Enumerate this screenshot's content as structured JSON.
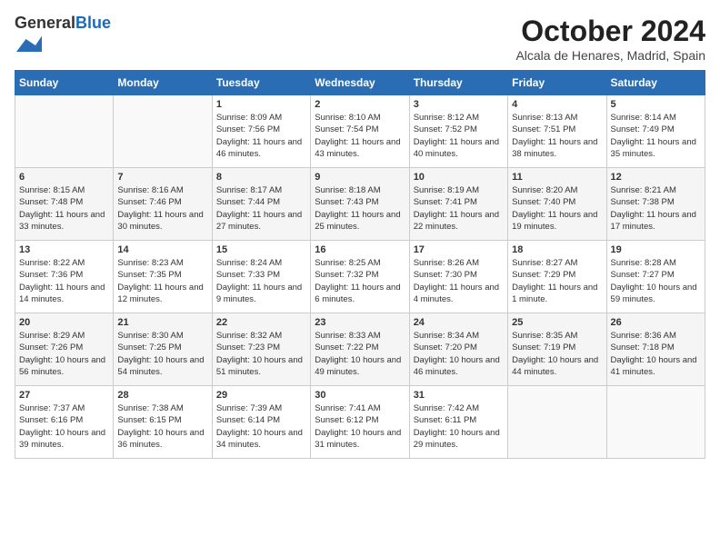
{
  "header": {
    "logo_general": "General",
    "logo_blue": "Blue",
    "month_title": "October 2024",
    "location": "Alcala de Henares, Madrid, Spain"
  },
  "weekdays": [
    "Sunday",
    "Monday",
    "Tuesday",
    "Wednesday",
    "Thursday",
    "Friday",
    "Saturday"
  ],
  "weeks": [
    [
      {
        "day": "",
        "sunrise": "",
        "sunset": "",
        "daylight": ""
      },
      {
        "day": "",
        "sunrise": "",
        "sunset": "",
        "daylight": ""
      },
      {
        "day": "1",
        "sunrise": "Sunrise: 8:09 AM",
        "sunset": "Sunset: 7:56 PM",
        "daylight": "Daylight: 11 hours and 46 minutes."
      },
      {
        "day": "2",
        "sunrise": "Sunrise: 8:10 AM",
        "sunset": "Sunset: 7:54 PM",
        "daylight": "Daylight: 11 hours and 43 minutes."
      },
      {
        "day": "3",
        "sunrise": "Sunrise: 8:12 AM",
        "sunset": "Sunset: 7:52 PM",
        "daylight": "Daylight: 11 hours and 40 minutes."
      },
      {
        "day": "4",
        "sunrise": "Sunrise: 8:13 AM",
        "sunset": "Sunset: 7:51 PM",
        "daylight": "Daylight: 11 hours and 38 minutes."
      },
      {
        "day": "5",
        "sunrise": "Sunrise: 8:14 AM",
        "sunset": "Sunset: 7:49 PM",
        "daylight": "Daylight: 11 hours and 35 minutes."
      }
    ],
    [
      {
        "day": "6",
        "sunrise": "Sunrise: 8:15 AM",
        "sunset": "Sunset: 7:48 PM",
        "daylight": "Daylight: 11 hours and 33 minutes."
      },
      {
        "day": "7",
        "sunrise": "Sunrise: 8:16 AM",
        "sunset": "Sunset: 7:46 PM",
        "daylight": "Daylight: 11 hours and 30 minutes."
      },
      {
        "day": "8",
        "sunrise": "Sunrise: 8:17 AM",
        "sunset": "Sunset: 7:44 PM",
        "daylight": "Daylight: 11 hours and 27 minutes."
      },
      {
        "day": "9",
        "sunrise": "Sunrise: 8:18 AM",
        "sunset": "Sunset: 7:43 PM",
        "daylight": "Daylight: 11 hours and 25 minutes."
      },
      {
        "day": "10",
        "sunrise": "Sunrise: 8:19 AM",
        "sunset": "Sunset: 7:41 PM",
        "daylight": "Daylight: 11 hours and 22 minutes."
      },
      {
        "day": "11",
        "sunrise": "Sunrise: 8:20 AM",
        "sunset": "Sunset: 7:40 PM",
        "daylight": "Daylight: 11 hours and 19 minutes."
      },
      {
        "day": "12",
        "sunrise": "Sunrise: 8:21 AM",
        "sunset": "Sunset: 7:38 PM",
        "daylight": "Daylight: 11 hours and 17 minutes."
      }
    ],
    [
      {
        "day": "13",
        "sunrise": "Sunrise: 8:22 AM",
        "sunset": "Sunset: 7:36 PM",
        "daylight": "Daylight: 11 hours and 14 minutes."
      },
      {
        "day": "14",
        "sunrise": "Sunrise: 8:23 AM",
        "sunset": "Sunset: 7:35 PM",
        "daylight": "Daylight: 11 hours and 12 minutes."
      },
      {
        "day": "15",
        "sunrise": "Sunrise: 8:24 AM",
        "sunset": "Sunset: 7:33 PM",
        "daylight": "Daylight: 11 hours and 9 minutes."
      },
      {
        "day": "16",
        "sunrise": "Sunrise: 8:25 AM",
        "sunset": "Sunset: 7:32 PM",
        "daylight": "Daylight: 11 hours and 6 minutes."
      },
      {
        "day": "17",
        "sunrise": "Sunrise: 8:26 AM",
        "sunset": "Sunset: 7:30 PM",
        "daylight": "Daylight: 11 hours and 4 minutes."
      },
      {
        "day": "18",
        "sunrise": "Sunrise: 8:27 AM",
        "sunset": "Sunset: 7:29 PM",
        "daylight": "Daylight: 11 hours and 1 minute."
      },
      {
        "day": "19",
        "sunrise": "Sunrise: 8:28 AM",
        "sunset": "Sunset: 7:27 PM",
        "daylight": "Daylight: 10 hours and 59 minutes."
      }
    ],
    [
      {
        "day": "20",
        "sunrise": "Sunrise: 8:29 AM",
        "sunset": "Sunset: 7:26 PM",
        "daylight": "Daylight: 10 hours and 56 minutes."
      },
      {
        "day": "21",
        "sunrise": "Sunrise: 8:30 AM",
        "sunset": "Sunset: 7:25 PM",
        "daylight": "Daylight: 10 hours and 54 minutes."
      },
      {
        "day": "22",
        "sunrise": "Sunrise: 8:32 AM",
        "sunset": "Sunset: 7:23 PM",
        "daylight": "Daylight: 10 hours and 51 minutes."
      },
      {
        "day": "23",
        "sunrise": "Sunrise: 8:33 AM",
        "sunset": "Sunset: 7:22 PM",
        "daylight": "Daylight: 10 hours and 49 minutes."
      },
      {
        "day": "24",
        "sunrise": "Sunrise: 8:34 AM",
        "sunset": "Sunset: 7:20 PM",
        "daylight": "Daylight: 10 hours and 46 minutes."
      },
      {
        "day": "25",
        "sunrise": "Sunrise: 8:35 AM",
        "sunset": "Sunset: 7:19 PM",
        "daylight": "Daylight: 10 hours and 44 minutes."
      },
      {
        "day": "26",
        "sunrise": "Sunrise: 8:36 AM",
        "sunset": "Sunset: 7:18 PM",
        "daylight": "Daylight: 10 hours and 41 minutes."
      }
    ],
    [
      {
        "day": "27",
        "sunrise": "Sunrise: 7:37 AM",
        "sunset": "Sunset: 6:16 PM",
        "daylight": "Daylight: 10 hours and 39 minutes."
      },
      {
        "day": "28",
        "sunrise": "Sunrise: 7:38 AM",
        "sunset": "Sunset: 6:15 PM",
        "daylight": "Daylight: 10 hours and 36 minutes."
      },
      {
        "day": "29",
        "sunrise": "Sunrise: 7:39 AM",
        "sunset": "Sunset: 6:14 PM",
        "daylight": "Daylight: 10 hours and 34 minutes."
      },
      {
        "day": "30",
        "sunrise": "Sunrise: 7:41 AM",
        "sunset": "Sunset: 6:12 PM",
        "daylight": "Daylight: 10 hours and 31 minutes."
      },
      {
        "day": "31",
        "sunrise": "Sunrise: 7:42 AM",
        "sunset": "Sunset: 6:11 PM",
        "daylight": "Daylight: 10 hours and 29 minutes."
      },
      {
        "day": "",
        "sunrise": "",
        "sunset": "",
        "daylight": ""
      },
      {
        "day": "",
        "sunrise": "",
        "sunset": "",
        "daylight": ""
      }
    ]
  ]
}
